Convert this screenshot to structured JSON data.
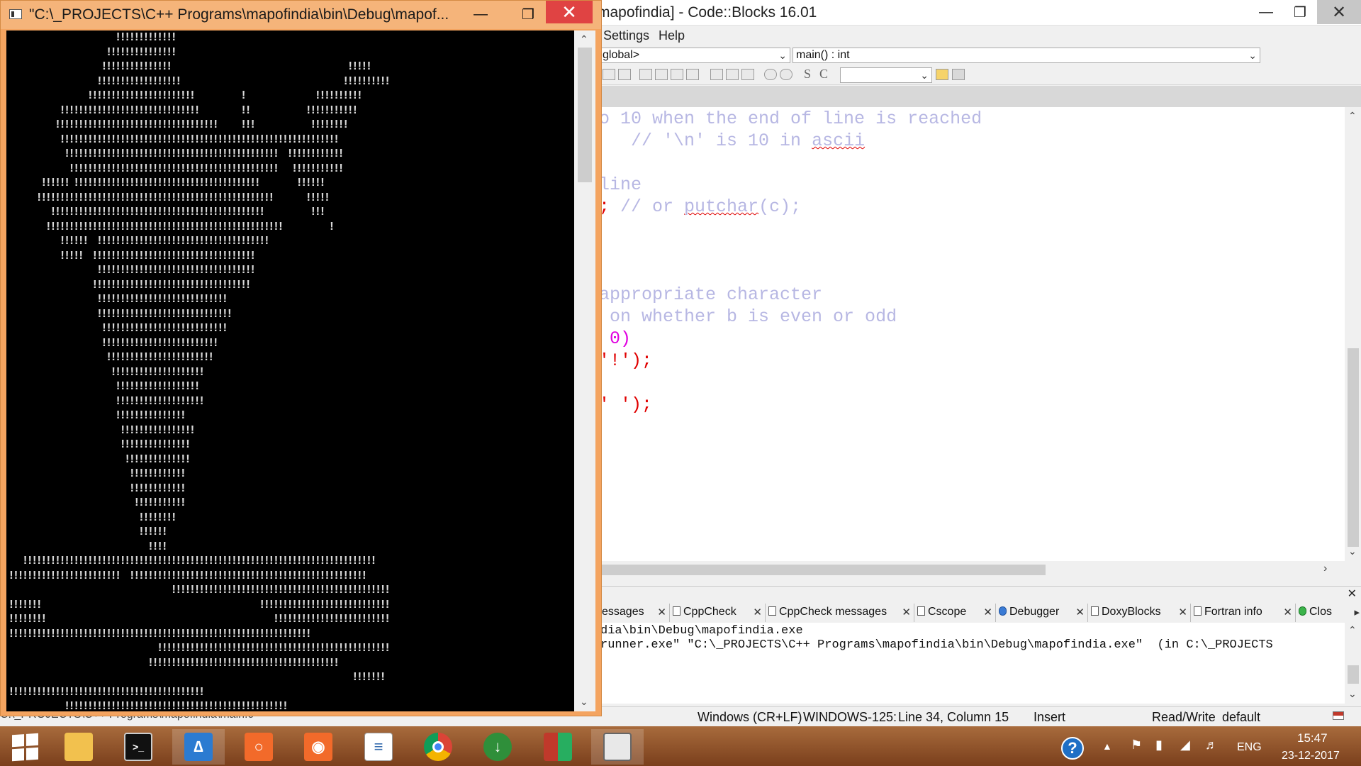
{
  "console": {
    "title": "\"C:\\_PROJECTS\\C++ Programs\\mapofindia\\bin\\Debug\\mapof...",
    "art_lines": [
      "                       !!!!!!!!!!!!!",
      "                     !!!!!!!!!!!!!!!",
      "                    !!!!!!!!!!!!!!!                                      !!!!!",
      "                   !!!!!!!!!!!!!!!!!!                                   !!!!!!!!!!",
      "                 !!!!!!!!!!!!!!!!!!!!!!!          !               !!!!!!!!!!",
      "           !!!!!!!!!!!!!!!!!!!!!!!!!!!!!!         !!            !!!!!!!!!!!",
      "          !!!!!!!!!!!!!!!!!!!!!!!!!!!!!!!!!!!     !!!            !!!!!!!!",
      "           !!!!!!!!!!!!!!!!!!!!!!!!!!!!!!!!!!!!!!!!!!!!!!!!!!!!!!!!!!!!",
      "            !!!!!!!!!!!!!!!!!!!!!!!!!!!!!!!!!!!!!!!!!!!!!!  !!!!!!!!!!!!",
      "             !!!!!!!!!!!!!!!!!!!!!!!!!!!!!!!!!!!!!!!!!!!!!   !!!!!!!!!!!",
      "       !!!!!! !!!!!!!!!!!!!!!!!!!!!!!!!!!!!!!!!!!!!!!!        !!!!!!",
      "      !!!!!!!!!!!!!!!!!!!!!!!!!!!!!!!!!!!!!!!!!!!!!!!!!!!       !!!!!",
      "         !!!!!!!!!!!!!!!!!!!!!!!!!!!!!!!!!!!!!!!!!!!!!!          !!!",
      "        !!!!!!!!!!!!!!!!!!!!!!!!!!!!!!!!!!!!!!!!!!!!!!!!!!!          !",
      "           !!!!!!  !!!!!!!!!!!!!!!!!!!!!!!!!!!!!!!!!!!!!",
      "           !!!!!  !!!!!!!!!!!!!!!!!!!!!!!!!!!!!!!!!!!",
      "                   !!!!!!!!!!!!!!!!!!!!!!!!!!!!!!!!!!",
      "                  !!!!!!!!!!!!!!!!!!!!!!!!!!!!!!!!!!",
      "                   !!!!!!!!!!!!!!!!!!!!!!!!!!!!",
      "                   !!!!!!!!!!!!!!!!!!!!!!!!!!!!!",
      "                    !!!!!!!!!!!!!!!!!!!!!!!!!!!",
      "                    !!!!!!!!!!!!!!!!!!!!!!!!!",
      "                     !!!!!!!!!!!!!!!!!!!!!!!",
      "                      !!!!!!!!!!!!!!!!!!!!",
      "                       !!!!!!!!!!!!!!!!!!",
      "                       !!!!!!!!!!!!!!!!!!!",
      "                       !!!!!!!!!!!!!!!",
      "                        !!!!!!!!!!!!!!!!",
      "                        !!!!!!!!!!!!!!!",
      "                         !!!!!!!!!!!!!!",
      "                          !!!!!!!!!!!!",
      "                          !!!!!!!!!!!!",
      "                           !!!!!!!!!!!",
      "                            !!!!!!!!",
      "                            !!!!!!",
      "                              !!!!",
      "   !!!!!!!!!!!!!!!!!!!!!!!!!!!!!!!!!!!!!!!!!!!!!!!!!!!!!!!!!!!!!!!!!!!!!!!!!!!!",
      "!!!!!!!!!!!!!!!!!!!!!!!!  !!!!!!!!!!!!!!!!!!!!!!!!!!!!!!!!!!!!!!!!!!!!!!!!!!!",
      "                                   !!!!!!!!!!!!!!!!!!!!!!!!!!!!!!!!!!!!!!!!!!!!!!!",
      "!!!!!!!                                               !!!!!!!!!!!!!!!!!!!!!!!!!!!!",
      "!!!!!!!!                                                 !!!!!!!!!!!!!!!!!!!!!!!!!",
      "!!!!!!!!!!!!!!!!!!!!!!!!!!!!!!!!!!!!!!!!!!!!!!!!!!!!!!!!!!!!!!!!!",
      "                                !!!!!!!!!!!!!!!!!!!!!!!!!!!!!!!!!!!!!!!!!!!!!!!!!!",
      "                              !!!!!!!!!!!!!!!!!!!!!!!!!!!!!!!!!!!!!!!!!",
      "                                                                          !!!!!!!",
      "!!!!!!!!!!!!!!!!!!!!!!!!!!!!!!!!!!!!!!!!!!",
      "            !!!!!!!!!!!!!!!!!!!!!!!!!!!!!!!!!!!!!!!!!!!!!!!!",
      "                              !!!!            !!!!!!!!!!!!!  !!!!!!!!!"
    ]
  },
  "ide": {
    "title": "mapofindia] - Code::Blocks 16.01",
    "menu": [
      "Settings",
      "Help"
    ],
    "scope_combo": "global>",
    "function_combo": "main() : int",
    "toolbar_glyphs": [
      "S",
      "C"
    ],
    "code": {
      "line1": "o 10 when the end of line is reached",
      "line2a": "   // '\\n' is 10 in ",
      "line2b": "ascii",
      "line3": "line",
      "line4a": ";",
      "line4b": " // or ",
      "line4c": "putchar",
      "line4d": "(c);",
      "line5": "appropriate character",
      "line6": " on whether b is even or odd",
      "line7": " 0)",
      "line8": "'!');",
      "line9": "' ');"
    },
    "logs": {
      "tabs": [
        "essages",
        "CppCheck",
        "CppCheck messages",
        "Cscope",
        "Debugger",
        "DoxyBlocks",
        "Fortran info",
        "Clos"
      ],
      "lines": [
        "dia\\bin\\Debug\\mapofindia.exe",
        "runner.exe\" \"C:\\_PROJECTS\\C++ Programs\\mapofindia\\bin\\Debug\\mapofindia.exe\"  (in C:\\_PROJECTS"
      ]
    },
    "status": {
      "file": "C:\\_PROJECTS\\C++ Programs\\mapofindia\\main.c",
      "eol": "Windows (CR+LF)",
      "encoding": "WINDOWS-125:",
      "position": "Line 34, Column 15",
      "mode": "Insert",
      "access": "Read/Write",
      "profile": "default"
    }
  },
  "taskbar": {
    "apps": [
      "file-explorer",
      "command-prompt",
      "visual-studio-code",
      "capture-tool",
      "screenshot-tool",
      "python-file",
      "chrome",
      "download-manager",
      "winrar",
      "codeblocks"
    ],
    "tray_language": "ENG",
    "clock_time": "15:47",
    "clock_date": "23-12-2017"
  },
  "colors": {
    "console_frame": "#f4a460",
    "console_close": "#e04343",
    "comment": "#b7b7e3",
    "code_red": "#e00000",
    "code_magenta": "#e000e0",
    "taskbar": "#8b4f28"
  }
}
